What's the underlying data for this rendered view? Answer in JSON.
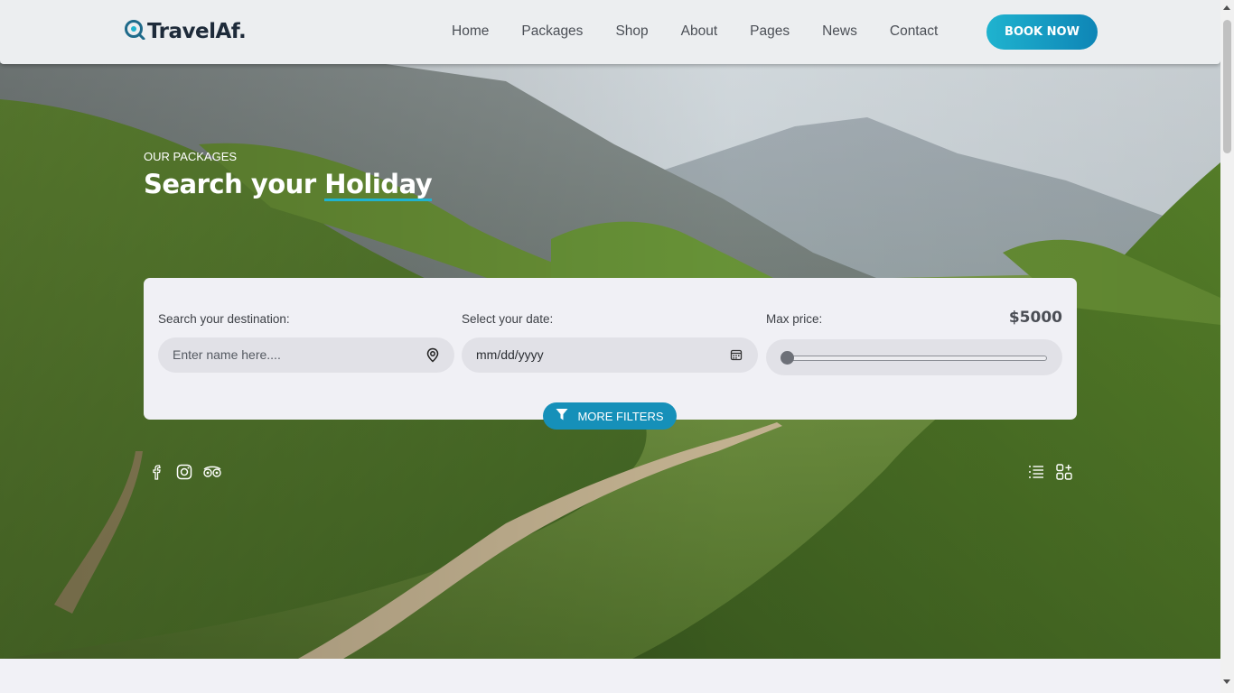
{
  "header": {
    "logo_text": "TravelAf.",
    "nav": [
      "Home",
      "Packages",
      "Shop",
      "About",
      "Pages",
      "News",
      "Contact"
    ],
    "book_label": "BOOK NOW"
  },
  "hero": {
    "eyebrow": "OUR PACKAGES",
    "title_prefix": "Search your ",
    "title_highlight": "Holiday"
  },
  "search": {
    "destination_label": "Search your destination:",
    "destination_placeholder": "Enter name here....",
    "date_label": "Select your date:",
    "date_placeholder": "mm/dd/yyyy",
    "price_label": "Max price:",
    "price_value": "$5000",
    "price_slider_fraction": 0,
    "more_filters_label": "MORE FILTERS"
  },
  "icons": {
    "social": [
      "facebook-icon",
      "instagram-icon",
      "tripadvisor-icon"
    ],
    "view": [
      "list-view-icon",
      "grid-view-icon"
    ]
  },
  "colors": {
    "accent": "#1fb3cf",
    "accent_dark": "#0e85b6",
    "filters_button": "#1690b9"
  }
}
